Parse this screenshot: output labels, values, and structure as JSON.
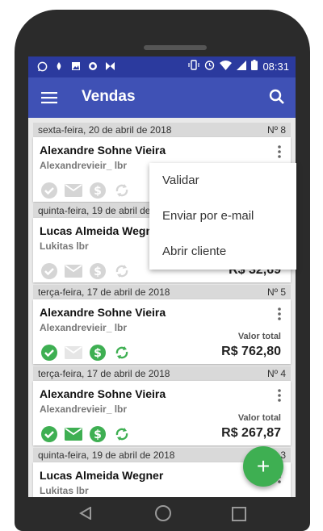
{
  "status": {
    "time": "08:31"
  },
  "appbar": {
    "title": "Vendas"
  },
  "colors": {
    "primary": "#3f51b5",
    "statusbar": "#2b3a9e",
    "green": "#3eaf52",
    "icon_gray": "#d5d5d5"
  },
  "sales": [
    {
      "date": "sexta-feira, 20 de abril de 2018",
      "number": "Nº 8",
      "customer": "Alexandre Sohne Vieira",
      "user": "Alexandrevieir_ lbr",
      "total_label": "",
      "total": "",
      "icons": [
        "check-gray",
        "mail-gray",
        "dollar-gray",
        "sync-gray"
      ]
    },
    {
      "date": "quinta-feira, 19 de abril de 2018",
      "number": "",
      "customer": "Lucas Almeida Wegner",
      "user": "Lukitas lbr",
      "total_label": "",
      "total": "R$ 32,69",
      "icons": [
        "check-gray",
        "mail-gray",
        "dollar-gray",
        "sync-gray"
      ]
    },
    {
      "date": "terça-feira, 17 de abril de 2018",
      "number": "Nº 5",
      "customer": "Alexandre Sohne Vieira",
      "user": "Alexandrevieir_ lbr",
      "total_label": "Valor total",
      "total": "R$ 762,80",
      "icons": [
        "check-green",
        "mail-gray",
        "dollar-green",
        "sync-green"
      ]
    },
    {
      "date": "terça-feira, 17 de abril de 2018",
      "number": "Nº 4",
      "customer": "Alexandre Sohne Vieira",
      "user": "Alexandrevieir_ lbr",
      "total_label": "Valor total",
      "total": "R$ 267,87",
      "icons": [
        "check-green",
        "mail-green",
        "dollar-green",
        "sync-green"
      ]
    },
    {
      "date": "quinta-feira, 19 de abril de 2018",
      "number": "3",
      "customer": "Lucas Almeida Wegner",
      "user": "Lukitas lbr",
      "total_label": "",
      "total": "",
      "icons": []
    }
  ],
  "context_menu": {
    "items": [
      "Validar",
      "Enviar por e-mail",
      "Abrir cliente"
    ]
  },
  "fab": {
    "label": "+"
  }
}
